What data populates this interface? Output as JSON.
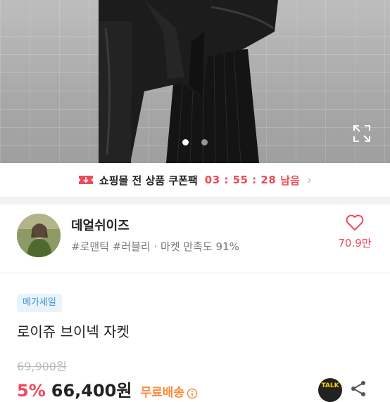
{
  "gallery": {
    "current_index": 1,
    "total": 2,
    "expand_icon": "expand-icon"
  },
  "coupon_banner": {
    "icon": "coupon-ticket-icon",
    "text": "쇼핑몰 전 상품 쿠폰팩",
    "timer": "03 : 55 : 28",
    "remaining": "남음",
    "arrow_icon": "chevron-right-icon"
  },
  "shop": {
    "name": "데얼쉬이즈",
    "tags": "#로맨틱 #러블리 · 마켓 만족도 91%",
    "like_icon": "heart-icon",
    "like_count": "70.9만"
  },
  "product": {
    "badge": "메가세일",
    "title": "로이쥬 브이넥 자켓",
    "original_price": "69,900원",
    "discount": "5%",
    "price": "66,400원",
    "shipping": "무료배송",
    "talk_label": "TALK",
    "share_icon": "share-icon"
  },
  "colors": {
    "accent": "#ef4a5a",
    "badge_text": "#3f92d8",
    "badge_bg": "#e9f3fb",
    "shipping": "#ff8a3d"
  }
}
